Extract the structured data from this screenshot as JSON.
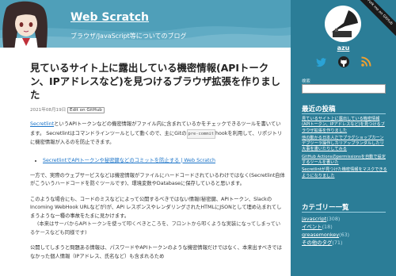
{
  "header": {
    "site_title": "Web Scratch",
    "description": "ブラウザ/JavaScript等についてのブログ"
  },
  "article": {
    "title": "見ているサイト上に露出している機密情報(APIトークン、IPアドレスなど)を見つけるブラウザ拡張を作りました",
    "date": "2021年08月19日",
    "edit_label": "Edit on GitHub",
    "p1_link": "Secretlint",
    "p1_a": "というAPIトークンなどの機密情報がファイル内に含まれているかをチェックできるツールを書いています。 Secretlintはコマンドラインツールとして動くので、主にGitの",
    "p1_code": "pre-commit",
    "p1_b": "hookを利用して、リポジトリに機密情報が入るのを防止できます。",
    "list_item": "SecretlintでAPIトークンや秘密鍵などのコミットを防止する | Web Scratch",
    "p2": "一方で、実際のウェブサービスなどは機密情報がファイルにハードコードされているわけではなく(Secretlint自体がこういうハードコードを防ぐツールです)、環境変数やDatabaseに保存していると思います。",
    "p3": "このような場合にも、コードのミスなどによって公開するべきではない情報(秘密鍵、APIトークン、SlackのIncoming WebHook URLなどが)が、API レスポンスやレンダリングされたHTMLにJSONとして埋め込まれてしまうような一種の事故をたまに見かけます。",
    "p3_note": "(本来はサーバからAPIトークンを使って叩くべきところを、フロントから叩くような実装になってしまっているケースなども同様です)",
    "p4": "公開してしまうと問題ある情報は、パスワードやAPIトークンのような機密情報だけではなく、本来出すべきではなかった個人情報（IPアドレス、氏名など）も含まれるため"
  },
  "sidebar": {
    "ribbon": "Fork me on GitHub",
    "user_name": "azu",
    "search_label": "検索",
    "search_value": "",
    "recent_title": "最近の投稿",
    "recent": [
      "見ているサイト上に露出している機密情報(APIトークン、IPアドレスなど)を見つけるブラウザ拡張を作りました",
      "他の動かる日本人だでプラグショップカーンデブツーラ操作しカリアップランダルしたリ大事を書いたりしてみる",
      "GitHub Actionsのpermissionsを自動で設定するツールを書いた",
      "Secretlintが見つけた機密情報をマスクできるようになりました"
    ],
    "category_title": "カテゴリー一覧",
    "categories": [
      {
        "name": "javascript",
        "count": "(308)"
      },
      {
        "name": "イベント",
        "count": "(18)"
      },
      {
        "name": "greasemonkey",
        "count": "(63)"
      },
      {
        "name": "その他のタグ",
        "count": "(71)"
      }
    ]
  },
  "colors": {
    "sidebar_bg": "#2b7d97",
    "header_bg": "#4f9fb9",
    "link": "#1a73c8",
    "twitter": "#2aa3d6",
    "github": "#222222",
    "rss": "#f0a030"
  },
  "icons": [
    "girl-avatar-icon",
    "gramophone-profile-icon",
    "twitter-icon",
    "github-icon",
    "rss-icon"
  ]
}
